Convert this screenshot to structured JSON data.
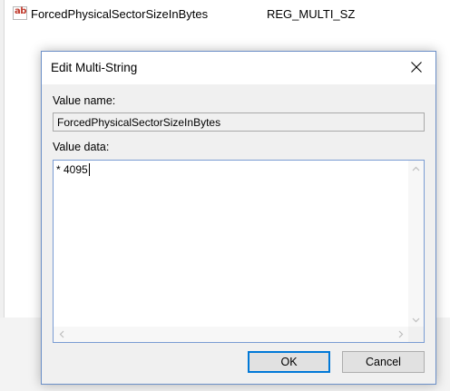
{
  "background": {
    "value_row": {
      "icon": "reg-string-icon",
      "icon_glyph": "ab",
      "name": "ForcedPhysicalSectorSizeInBytes",
      "type": "REG_MULTI_SZ"
    }
  },
  "dialog": {
    "title": "Edit Multi-String",
    "close_icon": "close-icon",
    "value_name_label": "Value name:",
    "value_name": "ForcedPhysicalSectorSizeInBytes",
    "value_data_label": "Value data:",
    "value_data": "* 4095",
    "ok_label": "OK",
    "cancel_label": "Cancel"
  },
  "colors": {
    "accent": "#0078d7",
    "dialog_bg": "#f0f0f0"
  }
}
